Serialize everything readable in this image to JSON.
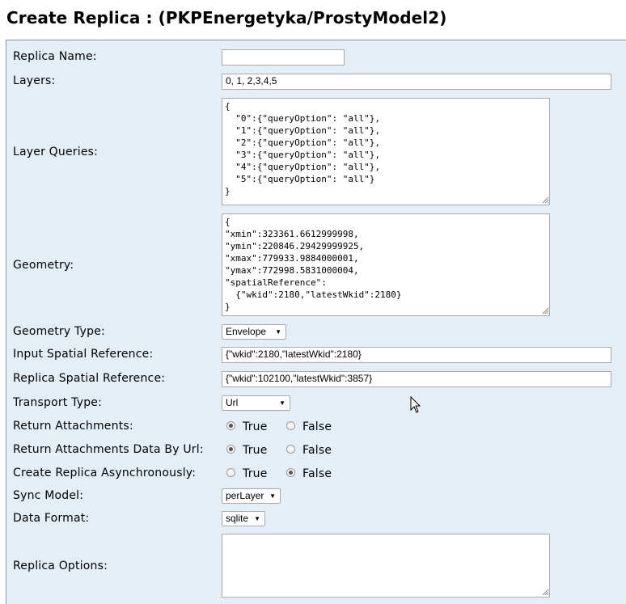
{
  "page": {
    "title": "Create Replica : (PKPEnergetyka/ProstyModel2)"
  },
  "form": {
    "replica_name": {
      "label": "Replica Name:",
      "value": ""
    },
    "layers": {
      "label": "Layers:",
      "value": "0, 1, 2,3,4,5"
    },
    "layer_queries": {
      "label": "Layer Queries:",
      "value": "{\n  \"0\":{\"queryOption\": \"all\"},\n  \"1\":{\"queryOption\": \"all\"},\n  \"2\":{\"queryOption\": \"all\"},\n  \"3\":{\"queryOption\": \"all\"},\n  \"4\":{\"queryOption\": \"all\"},\n  \"5\":{\"queryOption\": \"all\"}\n}"
    },
    "geometry": {
      "label": "Geometry:",
      "value": "{\n\"xmin\":323361.6612999998,\n\"ymin\":220846.29429999925,\n\"xmax\":779933.9884000001,\n\"ymax\":772998.5831000004,\n\"spatialReference\":\n  {\"wkid\":2180,\"latestWkid\":2180}\n}"
    },
    "geometry_type": {
      "label": "Geometry Type:",
      "value": "Envelope"
    },
    "input_sr": {
      "label": "Input Spatial Reference:",
      "value": "{\"wkid\":2180,\"latestWkid\":2180}"
    },
    "replica_sr": {
      "label": "Replica Spatial Reference:",
      "value": "{\"wkid\":102100,\"latestWkid\":3857}"
    },
    "transport_type": {
      "label": "Transport Type:",
      "value": "Url"
    },
    "return_attachments": {
      "label": "Return Attachments:",
      "true_label": "True",
      "false_label": "False",
      "selected": "True"
    },
    "return_attachments_by_url": {
      "label": "Return Attachments Data By Url:",
      "true_label": "True",
      "false_label": "False",
      "selected": "True"
    },
    "async": {
      "label": "Create Replica Asynchronously:",
      "true_label": "True",
      "false_label": "False",
      "selected": "False"
    },
    "sync_model": {
      "label": "Sync Model:",
      "value": "perLayer"
    },
    "data_format": {
      "label": "Data Format:",
      "value": "sqlite"
    },
    "replica_options": {
      "label": "Replica Options:",
      "value": ""
    }
  },
  "icons": {
    "dropdown": "triangle-down-icon",
    "cursor": "mouse-pointer-icon"
  }
}
